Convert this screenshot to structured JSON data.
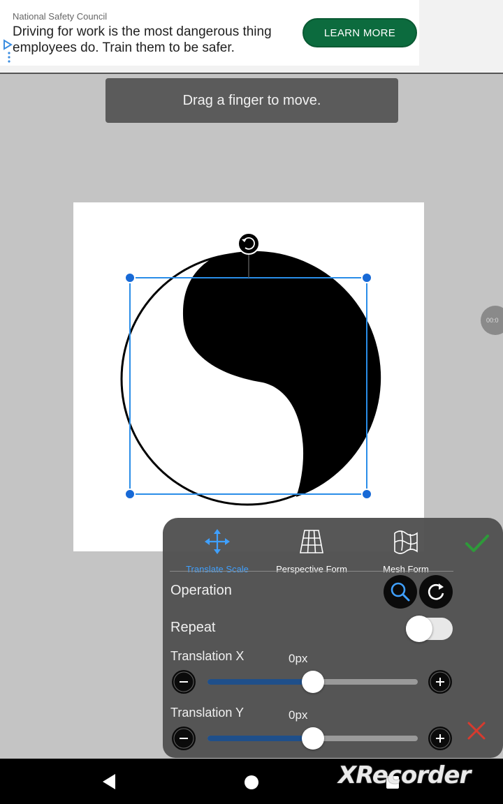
{
  "ad": {
    "sponsor": "National Safety Council",
    "headline": "Driving for work is the most dangerous thing employees do. Train them to be safer.",
    "cta_label": "LEARN MORE",
    "icon": "ad-choices-icon",
    "accent_color": "#0c6b3e"
  },
  "toast": {
    "message": "Drag a finger to move."
  },
  "recorder_bubble": {
    "text": "00:0"
  },
  "transform_panel": {
    "tabs": [
      {
        "label": "Translate Scale",
        "icon": "move-arrows-icon",
        "active": true
      },
      {
        "label": "Perspective Form",
        "icon": "perspective-grid-icon",
        "active": false
      },
      {
        "label": "Mesh Form",
        "icon": "mesh-warp-icon",
        "active": false
      }
    ],
    "active_color": "#3fa0ff",
    "operation_label": "Operation",
    "operation_buttons": [
      "zoom-icon",
      "rotate-icon"
    ],
    "repeat_label": "Repeat",
    "repeat_on": false,
    "translation_x": {
      "label": "Translation X",
      "value": "0px",
      "position": 0.5
    },
    "translation_y": {
      "label": "Translation Y",
      "value": "0px",
      "position": 0.5
    },
    "confirm_icon": "check-icon",
    "cancel_icon": "close-icon"
  },
  "navbar": {
    "buttons": [
      "back-icon",
      "home-icon",
      "recents-icon"
    ],
    "watermark": "XRecorder"
  }
}
